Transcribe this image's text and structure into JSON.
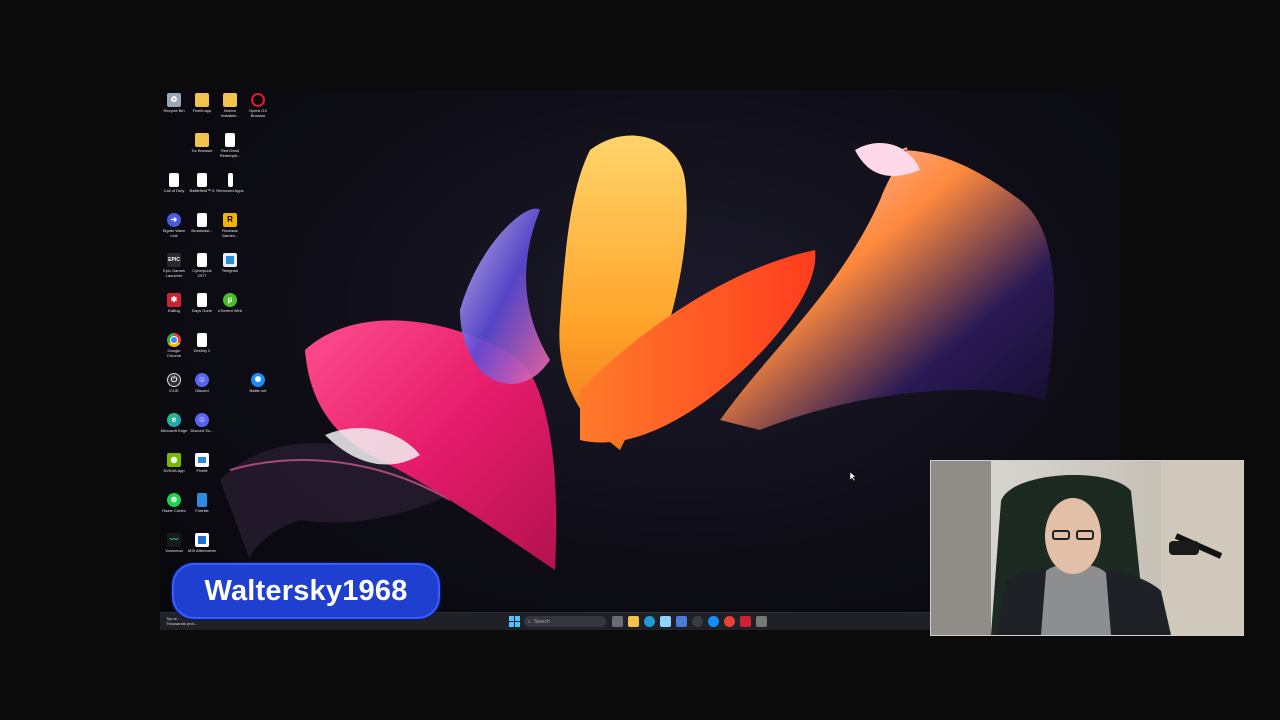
{
  "desktop_icons": [
    {
      "label": "Recycle Bin",
      "icon": "recycle-bin-icon",
      "color": "#9aa7b4"
    },
    {
      "label": "FiveM.app",
      "icon": "folder-icon",
      "color": "#f2c14e"
    },
    {
      "label": "Norton Installati...",
      "icon": "folder-icon",
      "color": "#f2c14e"
    },
    {
      "label": "Opera GX Browser",
      "icon": "opera-gx-icon",
      "color": "#e0182d"
    },
    {
      "label": "Tor Browser",
      "icon": "folder-icon",
      "color": "#f2c14e"
    },
    {
      "label": "Red Dead Redempti...",
      "icon": "file-icon",
      "color": "#ffffff"
    },
    {
      "label": "Call of Duty",
      "icon": "file-icon",
      "color": "#ffffff"
    },
    {
      "label": "Battlefield™ 6",
      "icon": "file-icon",
      "color": "#ffffff"
    },
    {
      "label": "Removed Apps",
      "icon": "file-icon",
      "color": "#ffffff"
    },
    {
      "label": "Elgato Wave Link",
      "icon": "wave-link-icon",
      "color": "#4a5be0"
    },
    {
      "label": "Broadcast...",
      "icon": "file-icon",
      "color": "#ffffff"
    },
    {
      "label": "Rockstar Games...",
      "icon": "rockstar-icon",
      "color": "#f5b301"
    },
    {
      "label": "Epic Games Launcher",
      "icon": "epic-games-icon",
      "color": "#2b2b2b"
    },
    {
      "label": "Cyberpunk 2077",
      "icon": "file-icon",
      "color": "#ffffff"
    },
    {
      "label": "Telegram",
      "icon": "telegram-icon",
      "color": "#e8eef5"
    },
    {
      "label": "EaBug",
      "icon": "eabug-icon",
      "color": "#cc2233"
    },
    {
      "label": "Days Gone",
      "icon": "file-icon",
      "color": "#ffffff"
    },
    {
      "label": "uTorrent Web",
      "icon": "utorrent-icon",
      "color": "#4bbf2b"
    },
    {
      "label": "Google Chrome",
      "icon": "chrome-icon",
      "color": "#e94235"
    },
    {
      "label": "Destiny 2",
      "icon": "file-icon",
      "color": "#ffffff"
    },
    {
      "label": "iCUE",
      "icon": "icue-icon",
      "color": "#333333"
    },
    {
      "label": "Discord",
      "icon": "discord-icon",
      "color": "#5865f2"
    },
    {
      "label": "Battle.net",
      "icon": "battlenet-icon",
      "color": "#148eff"
    },
    {
      "label": "Microsoft Edge",
      "icon": "edge-icon",
      "color": "#1f9ad6"
    },
    {
      "label": "Discord Su...",
      "icon": "discord-icon",
      "color": "#5865f2"
    },
    {
      "label": "NVIDIA App",
      "icon": "nvidia-icon",
      "color": "#76b900"
    },
    {
      "label": "FiveM",
      "icon": "fivem-icon",
      "color": "#2a8ad6"
    },
    {
      "label": "Razer Cortex",
      "icon": "razer-cortex-icon",
      "color": "#1bd34d"
    },
    {
      "label": "Fortnite",
      "icon": "fortnite-icon",
      "color": "#2c8ae0"
    },
    {
      "label": "Voicemod",
      "icon": "voicemod-icon",
      "color": "#1a1a1a"
    },
    {
      "label": "MSI Afterburner",
      "icon": "msi-afterburner-icon",
      "color": "#1d6fd1"
    }
  ],
  "taskbar": {
    "search_placeholder": "Search",
    "weather_line1": "Top st...",
    "weather_line2": "Thousands prot..."
  },
  "overlay": {
    "channel_name": "Waltersky1968"
  }
}
